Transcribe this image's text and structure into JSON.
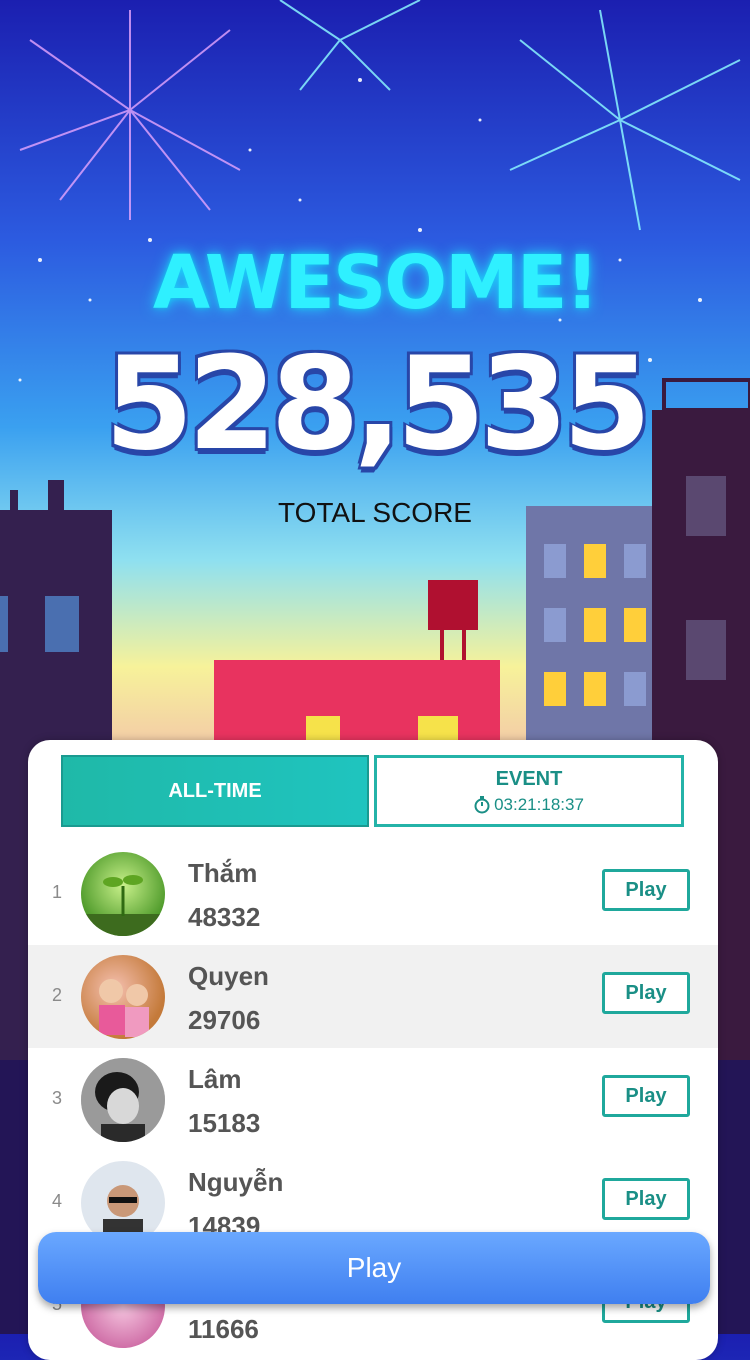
{
  "hero": {
    "headline": "AWESOME!",
    "score": "528,535",
    "score_label": "TOTAL SCORE"
  },
  "tabs": [
    {
      "label": "ALL-TIME",
      "active": true
    },
    {
      "label": "EVENT",
      "timer": "03:21:18:37",
      "active": false
    }
  ],
  "leaderboard": [
    {
      "rank": "1",
      "name": "Thắm",
      "score": "48332",
      "play_label": "Play",
      "avatar": "sprout-photo"
    },
    {
      "rank": "2",
      "name": "Quyen",
      "score": "29706",
      "play_label": "Play",
      "avatar": "family-photo"
    },
    {
      "rank": "3",
      "name": "Lâm",
      "score": "15183",
      "play_label": "Play",
      "avatar": "portrait-bw"
    },
    {
      "rank": "4",
      "name": "Nguyễn",
      "score": "14839",
      "play_label": "Play",
      "avatar": "sunglasses-photo"
    },
    {
      "rank": "5",
      "name": "",
      "score": "11666",
      "play_label": "Play",
      "avatar": "pink-photo"
    }
  ],
  "footer": {
    "play_label": "Play"
  },
  "colors": {
    "accent": "#1fb9a8",
    "play_button": "#4f8ef5",
    "headline": "#2ff0ff"
  }
}
